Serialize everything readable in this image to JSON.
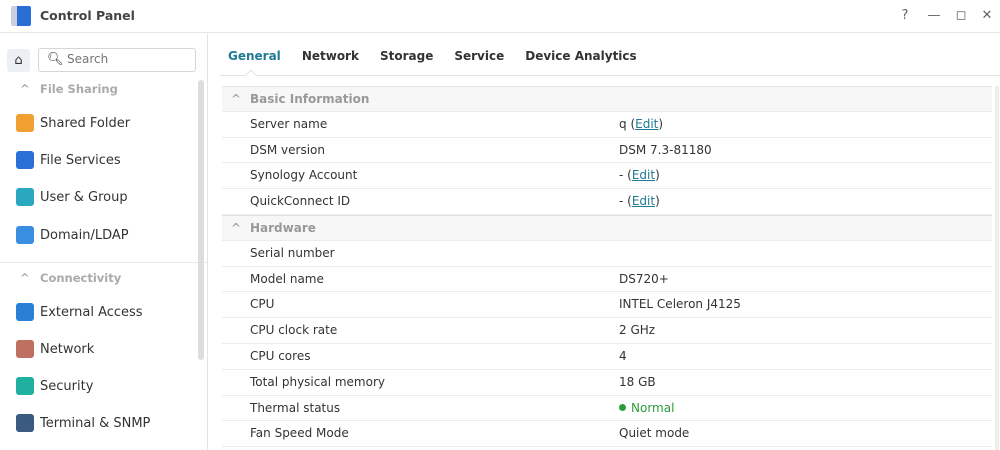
{
  "window": {
    "title": "Control Panel",
    "help": "?",
    "minimize": "—",
    "maximize": "◻",
    "close": "✕"
  },
  "sidebar": {
    "search_placeholder": "Search",
    "sections": [
      {
        "label": "File Sharing",
        "items": [
          {
            "label": "Shared Folder",
            "color": "#f0a030"
          },
          {
            "label": "File Services",
            "color": "#2a6fd6"
          },
          {
            "label": "User & Group",
            "color": "#2aa8c0"
          },
          {
            "label": "Domain/LDAP",
            "color": "#3a8ee0"
          }
        ]
      },
      {
        "label": "Connectivity",
        "items": [
          {
            "label": "External Access",
            "color": "#2a7fd6"
          },
          {
            "label": "Network",
            "color": "#c07060"
          },
          {
            "label": "Security",
            "color": "#20b0a0"
          },
          {
            "label": "Terminal & SNMP",
            "color": "#3a5a80"
          }
        ]
      }
    ]
  },
  "tabs": [
    "General",
    "Network",
    "Storage",
    "Service",
    "Device Analytics"
  ],
  "sections": [
    {
      "title": "Basic Information",
      "rows": [
        {
          "label": "Server name",
          "value": "q",
          "edit": "Edit"
        },
        {
          "label": "DSM version",
          "value": "DSM 7.3-81180"
        },
        {
          "label": "Synology Account",
          "value": "-",
          "edit": "Edit"
        },
        {
          "label": "QuickConnect ID",
          "value": "-",
          "edit": "Edit"
        }
      ]
    },
    {
      "title": "Hardware",
      "rows": [
        {
          "label": "Serial number",
          "value": ""
        },
        {
          "label": "Model name",
          "value": "DS720+"
        },
        {
          "label": "CPU",
          "value": "INTEL Celeron J4125"
        },
        {
          "label": "CPU clock rate",
          "value": "2 GHz"
        },
        {
          "label": "CPU cores",
          "value": "4"
        },
        {
          "label": "Total physical memory",
          "value": "18 GB"
        },
        {
          "label": "Thermal status",
          "value": "Normal",
          "status": "ok"
        },
        {
          "label": "Fan Speed Mode",
          "value": "Quiet mode"
        }
      ]
    }
  ]
}
